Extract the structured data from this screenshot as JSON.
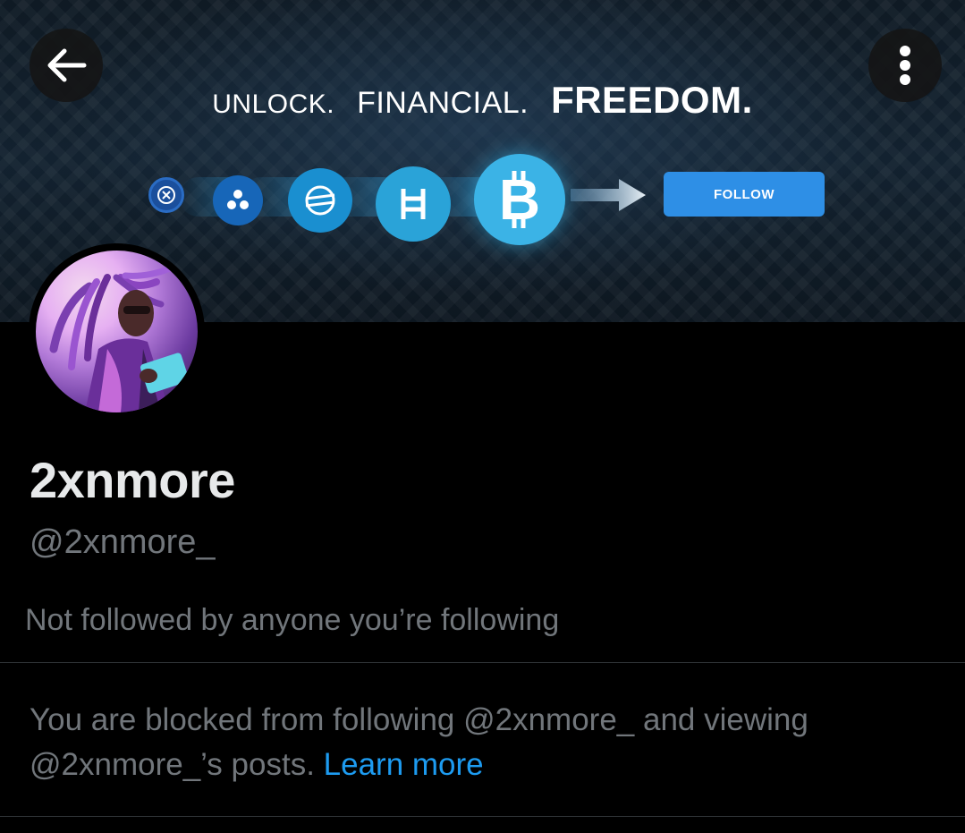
{
  "banner": {
    "tagline": {
      "word1": "UNLOCK.",
      "word2": "FINANCIAL.",
      "word3": "FREEDOM."
    },
    "follow_label": "FOLLOW",
    "coins": [
      "xdc-icon",
      "sol-icon",
      "xlm-icon",
      "hbar-icon",
      "bitcoin-icon"
    ]
  },
  "nav": {
    "back_icon": "arrow-left-icon",
    "more_icon": "more-vertical-icon"
  },
  "profile": {
    "display_name": "2xnmore",
    "handle": "@2xnmore_",
    "mutual_followers": "Not followed by anyone you’re following",
    "blocked_message": "You are blocked from following @2xnmore_ and viewing @2xnmore_’s posts.",
    "learn_more": "Learn more"
  },
  "colors": {
    "accent": "#1d9bf0",
    "muted": "#71767b",
    "text": "#e7e9ea",
    "background": "#000000"
  }
}
